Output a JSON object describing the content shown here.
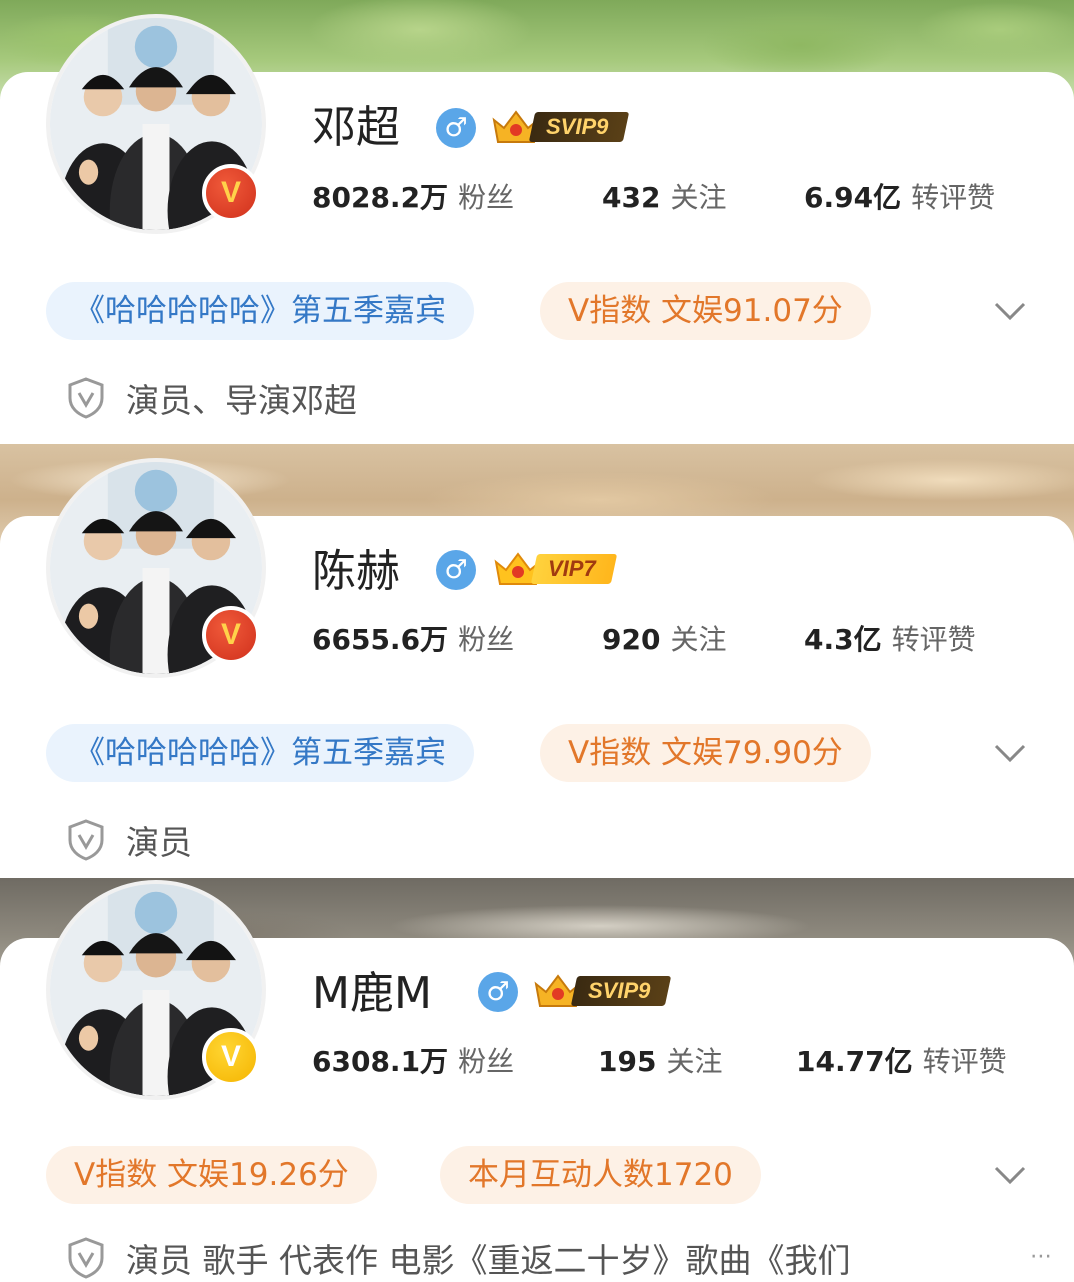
{
  "accent_colors": {
    "gender_blue": "#5aa6e8",
    "tag_blue": "#3478c6",
    "tag_orange": "#e2772a",
    "verified_red": "#d0301c",
    "verified_yellow": "#f5b400"
  },
  "profiles": [
    {
      "name": "邓超",
      "gender_symbol": "♂",
      "vip_label": "SVIP9",
      "verified_letter": "V",
      "stats": [
        {
          "value": "8028.2万",
          "label": "粉丝"
        },
        {
          "value": "432",
          "label": "关注"
        },
        {
          "value": "6.94亿",
          "label": "转评赞"
        }
      ],
      "tags": [
        "《哈哈哈哈哈》第五季嘉宾",
        "V指数 文娱91.07分"
      ],
      "description": "演员、导演邓超"
    },
    {
      "name": "陈赫",
      "gender_symbol": "♂",
      "vip_label": "VIP7",
      "verified_letter": "V",
      "stats": [
        {
          "value": "6655.6万",
          "label": "粉丝"
        },
        {
          "value": "920",
          "label": "关注"
        },
        {
          "value": "4.3亿",
          "label": "转评赞"
        }
      ],
      "tags": [
        "《哈哈哈哈哈》第五季嘉宾",
        "V指数 文娱79.90分"
      ],
      "description": "演员"
    },
    {
      "name": "M鹿M",
      "gender_symbol": "♂",
      "vip_label": "SVIP9",
      "verified_letter": "V",
      "stats": [
        {
          "value": "6308.1万",
          "label": "粉丝"
        },
        {
          "value": "195",
          "label": "关注"
        },
        {
          "value": "14.77亿",
          "label": "转评赞"
        }
      ],
      "tags": [
        "V指数 文娱19.26分",
        "本月互动人数1720"
      ],
      "description": "演员 歌手 代表作 电影《重返二十岁》歌曲《我们"
    }
  ],
  "expand_icon": "chevron-down-icon",
  "shield_icon": "shield-v-icon",
  "overflow_indicator": "⋯"
}
